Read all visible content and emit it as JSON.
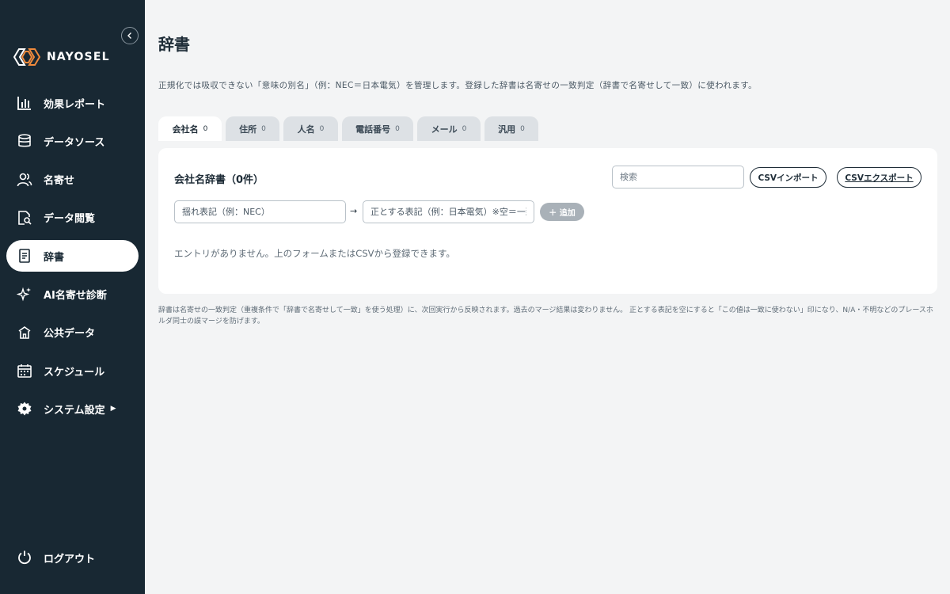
{
  "app": {
    "name": "NAYOSEL"
  },
  "sidebar": {
    "items": [
      {
        "label": "効果レポート",
        "icon": "bar-chart-icon"
      },
      {
        "label": "データソース",
        "icon": "database-icon"
      },
      {
        "label": "名寄せ",
        "icon": "users-icon"
      },
      {
        "label": "データ閲覧",
        "icon": "document-search-icon"
      },
      {
        "label": "辞書",
        "icon": "book-icon",
        "active": true
      },
      {
        "label": "AI名寄せ診断",
        "icon": "sparkles-icon"
      },
      {
        "label": "公共データ",
        "icon": "building-icon"
      },
      {
        "label": "スケジュール",
        "icon": "calendar-icon"
      },
      {
        "label": "システム設定",
        "icon": "gear-icon",
        "arrow": "▶"
      }
    ],
    "logout_label": "ログアウト"
  },
  "page": {
    "title": "辞書",
    "description": "正規化では吸収できない「意味の別名」（例：NEC＝日本電気）を管理します。登録した辞書は名寄せの一致判定（辞書で名寄せして一致）に使われます。"
  },
  "tabs": [
    {
      "label": "会社名",
      "count": "0",
      "active": true
    },
    {
      "label": "住所",
      "count": "0"
    },
    {
      "label": "人名",
      "count": "0"
    },
    {
      "label": "電話番号",
      "count": "0"
    },
    {
      "label": "メール",
      "count": "0"
    },
    {
      "label": "汎用",
      "count": "0"
    }
  ],
  "card": {
    "title": "会社名辞書（0件）",
    "search_placeholder": "検索",
    "import_label": "CSVインポート",
    "export_label": "CSVエクスポート",
    "from_placeholder": "揺れ表記（例：NEC）",
    "arrow": "→",
    "to_placeholder": "正とする表記（例：日本電気）※空＝一致",
    "add_label": "＋ 追加",
    "empty_message": "エントリがありません。上のフォームまたはCSVから登録できます。"
  },
  "footnote": "辞書は名寄せの一致判定（重複条件で「辞書で名寄せして一致」を使う処理）に、次回実行から反映されます。過去のマージ結果は変わりません。 正とする表記を空にすると「この値は一致に使わない」印になり、N/A・不明などのプレースホルダ同士の誤マージを防げます。",
  "colors": {
    "sidebar_bg": "#182833",
    "page_bg": "#f3f4f5",
    "logo_orange": "#f08a3c"
  }
}
